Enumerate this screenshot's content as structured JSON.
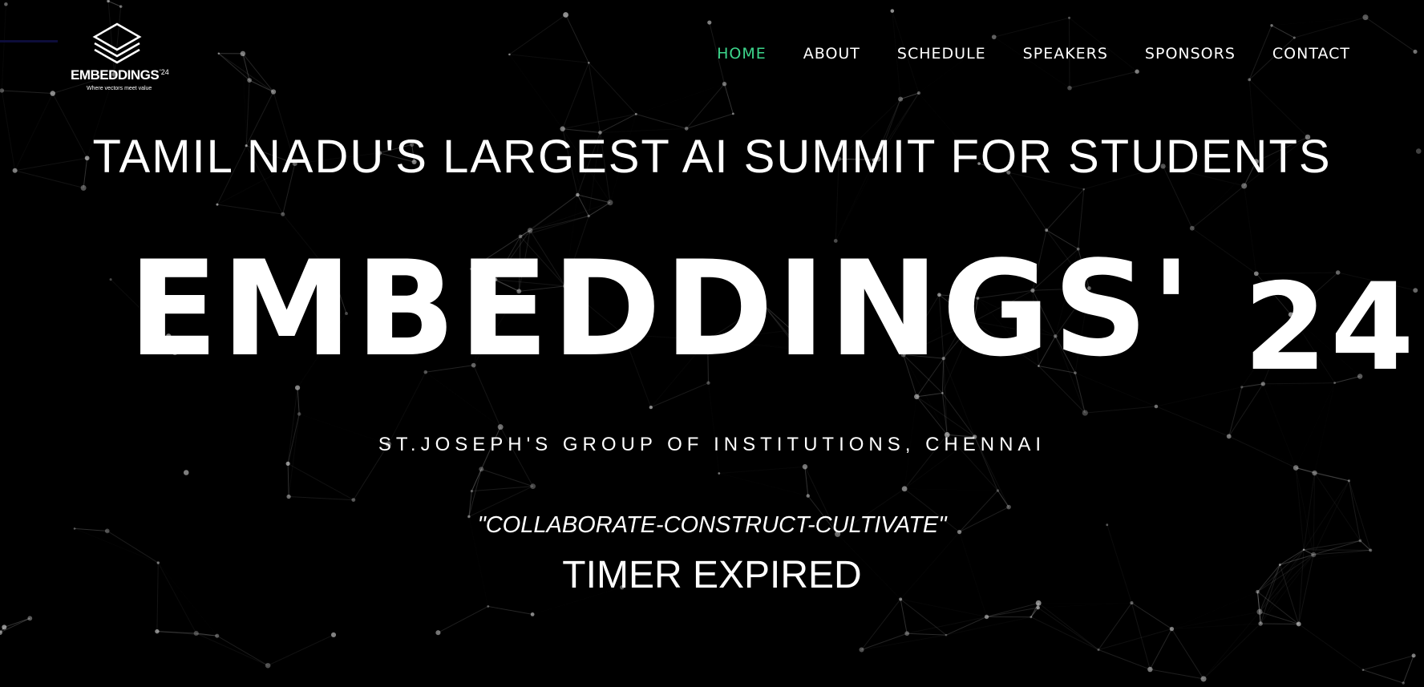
{
  "logo": {
    "wordmark": "EMBEDDINGS",
    "superscript": "'24",
    "tagline": "Where vectors meet value"
  },
  "nav": {
    "items": [
      {
        "label": "HOME",
        "active": true
      },
      {
        "label": "ABOUT"
      },
      {
        "label": "SCHEDULE"
      },
      {
        "label": "SPEAKERS"
      },
      {
        "label": "SPONSORS"
      },
      {
        "label": "CONTACT"
      }
    ]
  },
  "hero": {
    "subtitle": "TAMIL NADU'S LARGEST AI SUMMIT FOR STUDENTS",
    "title_main": "EMBEDDINGS'",
    "title_year": "24",
    "venue": "ST.JOSEPH'S GROUP OF INSTITUTIONS, CHENNAI",
    "motto": "\"COLLABORATE-CONSTRUCT-CULTIVATE\"",
    "timer": "TIMER EXPIRED"
  },
  "colors": {
    "background": "#000000",
    "text": "#ffffff",
    "accent": "#3dd68c"
  },
  "icons": {
    "logo_mark": "stacked-diamond-icon"
  }
}
